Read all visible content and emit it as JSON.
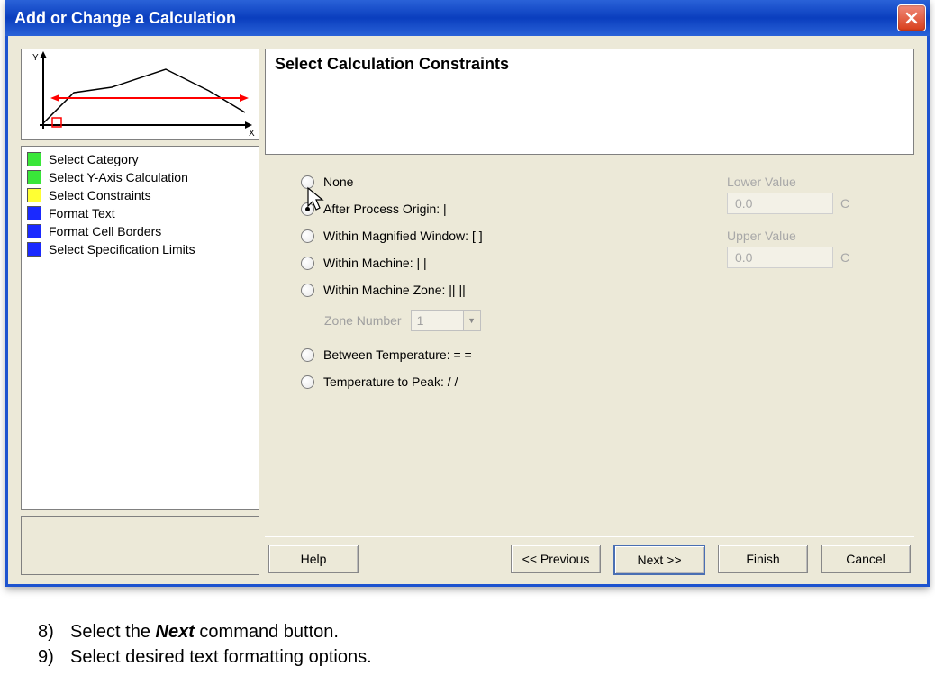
{
  "titlebar": {
    "title": "Add or Change a Calculation",
    "close_label": "X"
  },
  "left_panel": {
    "graph": {
      "y_label": "Y",
      "x_label": "X"
    },
    "steps": [
      {
        "color": "#39e639",
        "label": "Select Category"
      },
      {
        "color": "#39e639",
        "label": "Select Y-Axis Calculation"
      },
      {
        "color": "#ffff33",
        "label": "Select Constraints"
      },
      {
        "color": "#1a29ff",
        "label": "Format Text"
      },
      {
        "color": "#1a29ff",
        "label": "Format Cell Borders"
      },
      {
        "color": "#1a29ff",
        "label": "Select Specification Limits"
      }
    ]
  },
  "main": {
    "header_title": "Select Calculation Constraints",
    "options": [
      {
        "label": "None",
        "checked": false
      },
      {
        "label": "After Process Origin: |",
        "checked": true
      },
      {
        "label": "Within Magnified Window: [  ]",
        "checked": false
      },
      {
        "label": "Within Machine: |  |",
        "checked": false
      },
      {
        "label": "Within Machine Zone: ||  ||",
        "checked": false
      },
      {
        "label": "Between Temperature: =  =",
        "checked": false
      },
      {
        "label": "Temperature to Peak: /  /",
        "checked": false
      }
    ],
    "zone_label": "Zone Number",
    "zone_value": "1",
    "lower_label": "Lower Value",
    "lower_value": "0.0",
    "lower_unit": "C",
    "upper_label": "Upper Value",
    "upper_value": "0.0",
    "upper_unit": "C"
  },
  "buttons": {
    "help": "Help",
    "prev": "<< Previous",
    "next": "Next >>",
    "finish": "Finish",
    "cancel": "Cancel"
  },
  "instructions": {
    "item8_num": "8)",
    "item8_pre": "Select the ",
    "item8_bold": "Next",
    "item8_post": " command button.",
    "item9_num": "9)",
    "item9_text": "Select desired text formatting options."
  }
}
